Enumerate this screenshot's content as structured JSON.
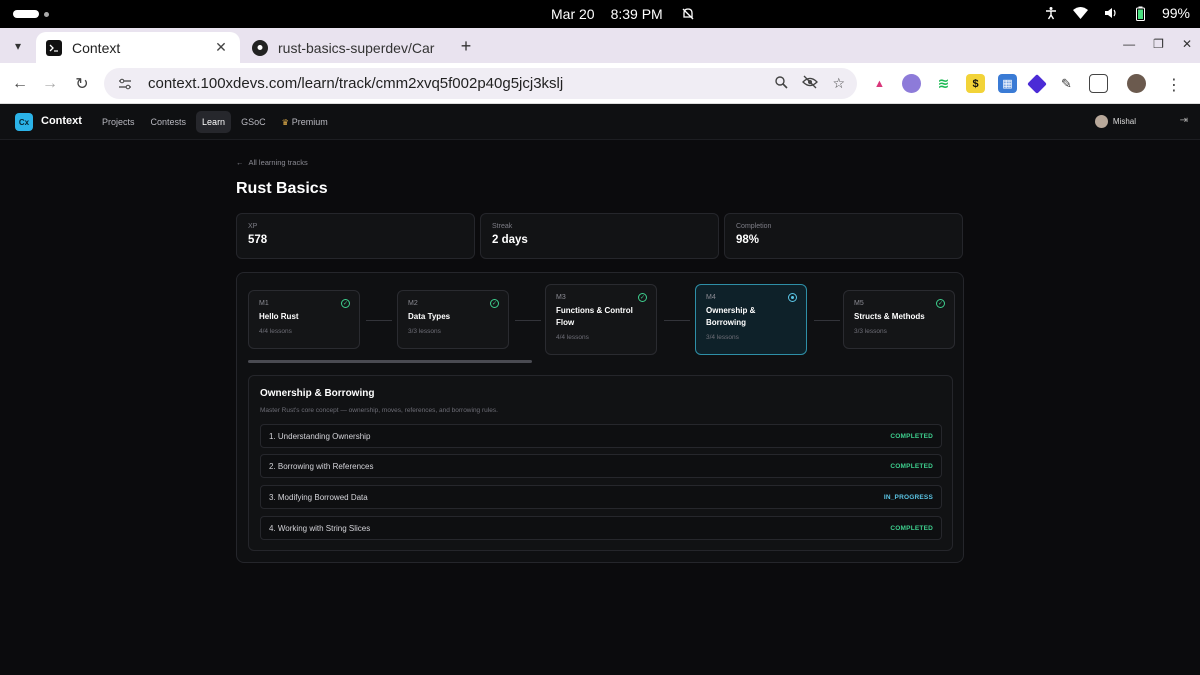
{
  "os": {
    "date": "Mar 20",
    "time": "8:39 PM",
    "battery": "99%"
  },
  "browser": {
    "tabs": [
      {
        "title": "Context",
        "active": true
      },
      {
        "title": "rust-basics-superdev/Car",
        "active": false
      }
    ],
    "url": "context.100xdevs.com/learn/track/cmm2xvq5f002p40g5jcj3kslj"
  },
  "app": {
    "logo_mark": "Cx",
    "brand": "Context",
    "nav": [
      "Projects",
      "Contests",
      "Learn",
      "GSoC",
      "Premium"
    ],
    "user_name": "Mishal"
  },
  "page": {
    "back_link": "All learning tracks",
    "title": "Rust Basics"
  },
  "stats": [
    {
      "label": "XP",
      "value": "578"
    },
    {
      "label": "Streak",
      "value": "2 days"
    },
    {
      "label": "Completion",
      "value": "98%"
    }
  ],
  "modules": [
    {
      "code": "M1",
      "title": "Hello Rust",
      "lessons": "4/4 lessons",
      "state": "completed"
    },
    {
      "code": "M2",
      "title": "Data Types",
      "lessons": "3/3 lessons",
      "state": "completed"
    },
    {
      "code": "M3",
      "title": "Functions & Control Flow",
      "lessons": "4/4 lessons",
      "state": "completed"
    },
    {
      "code": "M4",
      "title": "Ownership & Borrowing",
      "lessons": "3/4 lessons",
      "state": "current"
    },
    {
      "code": "M5",
      "title": "Structs & Methods",
      "lessons": "3/3 lessons",
      "state": "completed"
    }
  ],
  "detail": {
    "title": "Ownership & Borrowing",
    "description": "Master Rust's core concept — ownership, moves, references, and borrowing rules.",
    "lessons": [
      {
        "name": "1. Understanding Ownership",
        "status": "COMPLETED"
      },
      {
        "name": "2. Borrowing with References",
        "status": "COMPLETED"
      },
      {
        "name": "3. Modifying Borrowed Data",
        "status": "IN_PROGRESS"
      },
      {
        "name": "4. Working with String Slices",
        "status": "COMPLETED"
      }
    ]
  },
  "colors": {
    "accent": "#2bb3e8",
    "completed": "#3ecf8e",
    "in_progress": "#5bc6e6"
  }
}
